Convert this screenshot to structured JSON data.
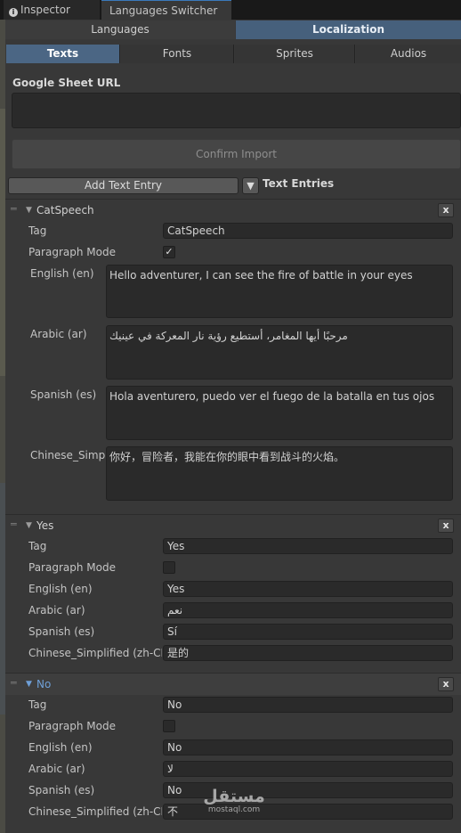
{
  "window_tabs": {
    "inspector": "Inspector",
    "languages_switcher": "Languages Switcher"
  },
  "main_tabs": {
    "languages": "Languages",
    "localization": "Localization"
  },
  "sub_tabs": {
    "texts": "Texts",
    "fonts": "Fonts",
    "sprites": "Sprites",
    "audios": "Audios"
  },
  "google_sheet": {
    "label": "Google Sheet URL",
    "value": "",
    "confirm_label": "Confirm Import"
  },
  "toolbar": {
    "add_text_entry": "Add Text Entry",
    "text_entries_label": "Text Entries"
  },
  "labels": {
    "tag": "Tag",
    "paragraph_mode": "Paragraph Mode",
    "close": "x"
  },
  "entries": [
    {
      "title": "CatSpeech",
      "tag": "CatSpeech",
      "paragraph_mode": true,
      "languages": [
        {
          "label": "English (en)",
          "value": "Hello adventurer, I can see the fire of battle in your eyes"
        },
        {
          "label": "Arabic (ar)",
          "value": "مرحبًا أيها المغامر، أستطيع رؤية نار المعركة في عينيك"
        },
        {
          "label": "Spanish (es)",
          "value": "Hola aventurero, puedo ver el fuego de la batalla en tus ojos"
        },
        {
          "label": "Chinese_Simp",
          "value": "你好，冒险者，我能在你的眼中看到战斗的火焰。"
        }
      ]
    },
    {
      "title": "Yes",
      "tag": "Yes",
      "paragraph_mode": false,
      "languages": [
        {
          "label": "English (en)",
          "value": "Yes"
        },
        {
          "label": "Arabic (ar)",
          "value": "نعم"
        },
        {
          "label": "Spanish (es)",
          "value": "Sí"
        },
        {
          "label": "Chinese_Simplified (zh-CN",
          "value": "是的"
        }
      ]
    },
    {
      "title": "No",
      "tag": "No",
      "paragraph_mode": false,
      "languages": [
        {
          "label": "English (en)",
          "value": "No"
        },
        {
          "label": "Arabic (ar)",
          "value": "لا"
        },
        {
          "label": "Spanish (es)",
          "value": "No"
        },
        {
          "label": "Chinese_Simplified (zh-CN",
          "value": "不"
        }
      ]
    }
  ],
  "watermark": {
    "arabic": "مستقل",
    "latin": "mostaql.com"
  },
  "colors": {
    "accent": "#46607c",
    "selected_title": "#6fa0d8",
    "background": "#383838"
  }
}
